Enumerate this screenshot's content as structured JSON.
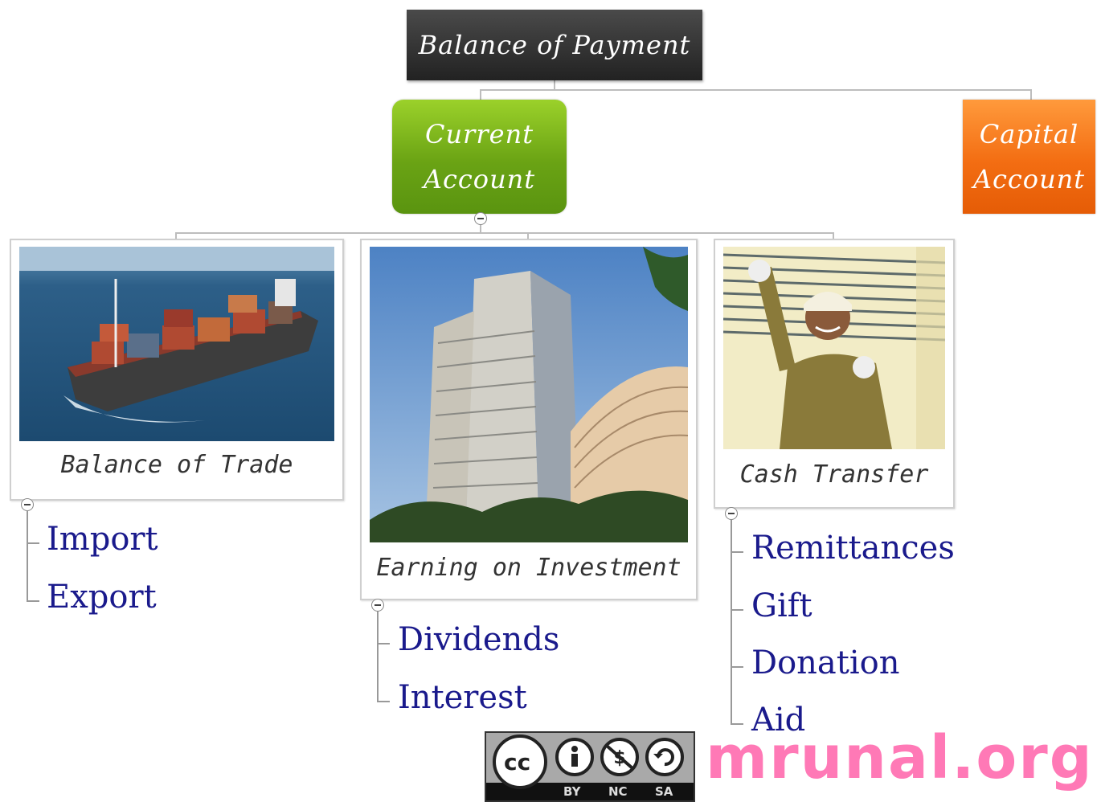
{
  "root": {
    "label": "Balance of Payment"
  },
  "branches": {
    "current": {
      "line1": "Current",
      "line2": "Account",
      "color": "#6aa314"
    },
    "capital": {
      "line1": "Capital",
      "line2": "Account",
      "color": "#f36d12"
    }
  },
  "cards": [
    {
      "caption": "Balance of Trade",
      "image": "cargo-ship-photo",
      "leaves": [
        "Import",
        "Export"
      ]
    },
    {
      "caption": "Earning on Investment",
      "image": "stock-exchange-building-photo",
      "leaves": [
        "Dividends",
        "Interest"
      ]
    },
    {
      "caption": "Cash Transfer",
      "image": "worker-thumbs-up-photo",
      "leaves": [
        "Remittances",
        "Gift",
        "Donation",
        "Aid"
      ]
    }
  ],
  "license": {
    "cc": "cc",
    "by": "BY",
    "nc": "NC",
    "sa": "SA"
  },
  "brand": {
    "text": "mrunal.org",
    "color": "#ff79b6"
  },
  "colors": {
    "leaf_text": "#1a1a8c",
    "root_bg": "#333333"
  }
}
